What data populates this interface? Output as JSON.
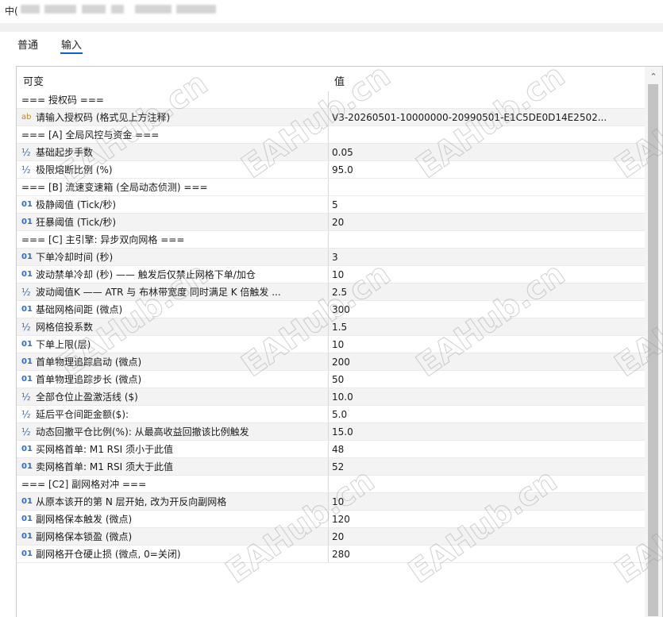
{
  "window": {
    "title": "中("
  },
  "tabs": [
    {
      "label": "普通",
      "active": false
    },
    {
      "label": "输入",
      "active": true
    }
  ],
  "grid": {
    "header": {
      "name": "可变",
      "value": "值"
    },
    "rows": [
      {
        "icon": "",
        "label": "=== 授权码 ===",
        "value": ""
      },
      {
        "icon": "ab",
        "label": "请输入授权码 (格式见上方注释)",
        "value": "V3-20260501-10000000-20990501-E1C5DE0D14E2502..."
      },
      {
        "icon": "",
        "label": "=== [A] 全局风控与资金 ===",
        "value": ""
      },
      {
        "icon": "½",
        "label": "基础起步手数",
        "value": "0.05"
      },
      {
        "icon": "½",
        "label": "极限熔断比例 (%)",
        "value": "95.0"
      },
      {
        "icon": "",
        "label": "=== [B] 流速变速箱 (全局动态侦测) ===",
        "value": ""
      },
      {
        "icon": "01",
        "label": "极静阈值 (Tick/秒)",
        "value": "5"
      },
      {
        "icon": "01",
        "label": "狂暴阈值 (Tick/秒)",
        "value": "20"
      },
      {
        "icon": "",
        "label": "=== [C] 主引擎: 异步双向网格 ===",
        "value": ""
      },
      {
        "icon": "01",
        "label": "下单冷却时间 (秒)",
        "value": "3"
      },
      {
        "icon": "01",
        "label": "波动禁单冷却 (秒) —— 触发后仅禁止网格下单/加仓",
        "value": "10"
      },
      {
        "icon": "½",
        "label": "波动阈值K —— ATR 与 布林带宽度 同时满足 K 倍触发 ...",
        "value": "2.5"
      },
      {
        "icon": "01",
        "label": "基础网格间距 (微点)",
        "value": "300"
      },
      {
        "icon": "½",
        "label": "网格倍投系数",
        "value": "1.5"
      },
      {
        "icon": "01",
        "label": "下单上限(层)",
        "value": "10"
      },
      {
        "icon": "01",
        "label": "首单物理追踪启动 (微点)",
        "value": "200"
      },
      {
        "icon": "01",
        "label": "首单物理追踪步长 (微点)",
        "value": "50"
      },
      {
        "icon": "½",
        "label": "全部仓位止盈激活线 ($)",
        "value": "10.0"
      },
      {
        "icon": "½",
        "label": "延后平仓间距金额($):",
        "value": "5.0"
      },
      {
        "icon": "½",
        "label": "动态回撤平仓比例(%): 从最高收益回撤该比例触发",
        "value": "15.0"
      },
      {
        "icon": "01",
        "label": "买网格首单: M1 RSI 须小于此值",
        "value": "48"
      },
      {
        "icon": "01",
        "label": "卖网格首单: M1 RSI 须大于此值",
        "value": "52"
      },
      {
        "icon": "",
        "label": "=== [C2] 副网格对冲 ===",
        "value": ""
      },
      {
        "icon": "01",
        "label": "从原本该开的第 N 层开始, 改为开反向副网格",
        "value": "10"
      },
      {
        "icon": "01",
        "label": "副网格保本触发 (微点)",
        "value": "120"
      },
      {
        "icon": "01",
        "label": "副网格保本锁盈 (微点)",
        "value": "20"
      },
      {
        "icon": "01",
        "label": "副网格开仓硬止损 (微点, 0=关闭)",
        "value": "280"
      }
    ]
  },
  "watermark": "EAHub.cn"
}
